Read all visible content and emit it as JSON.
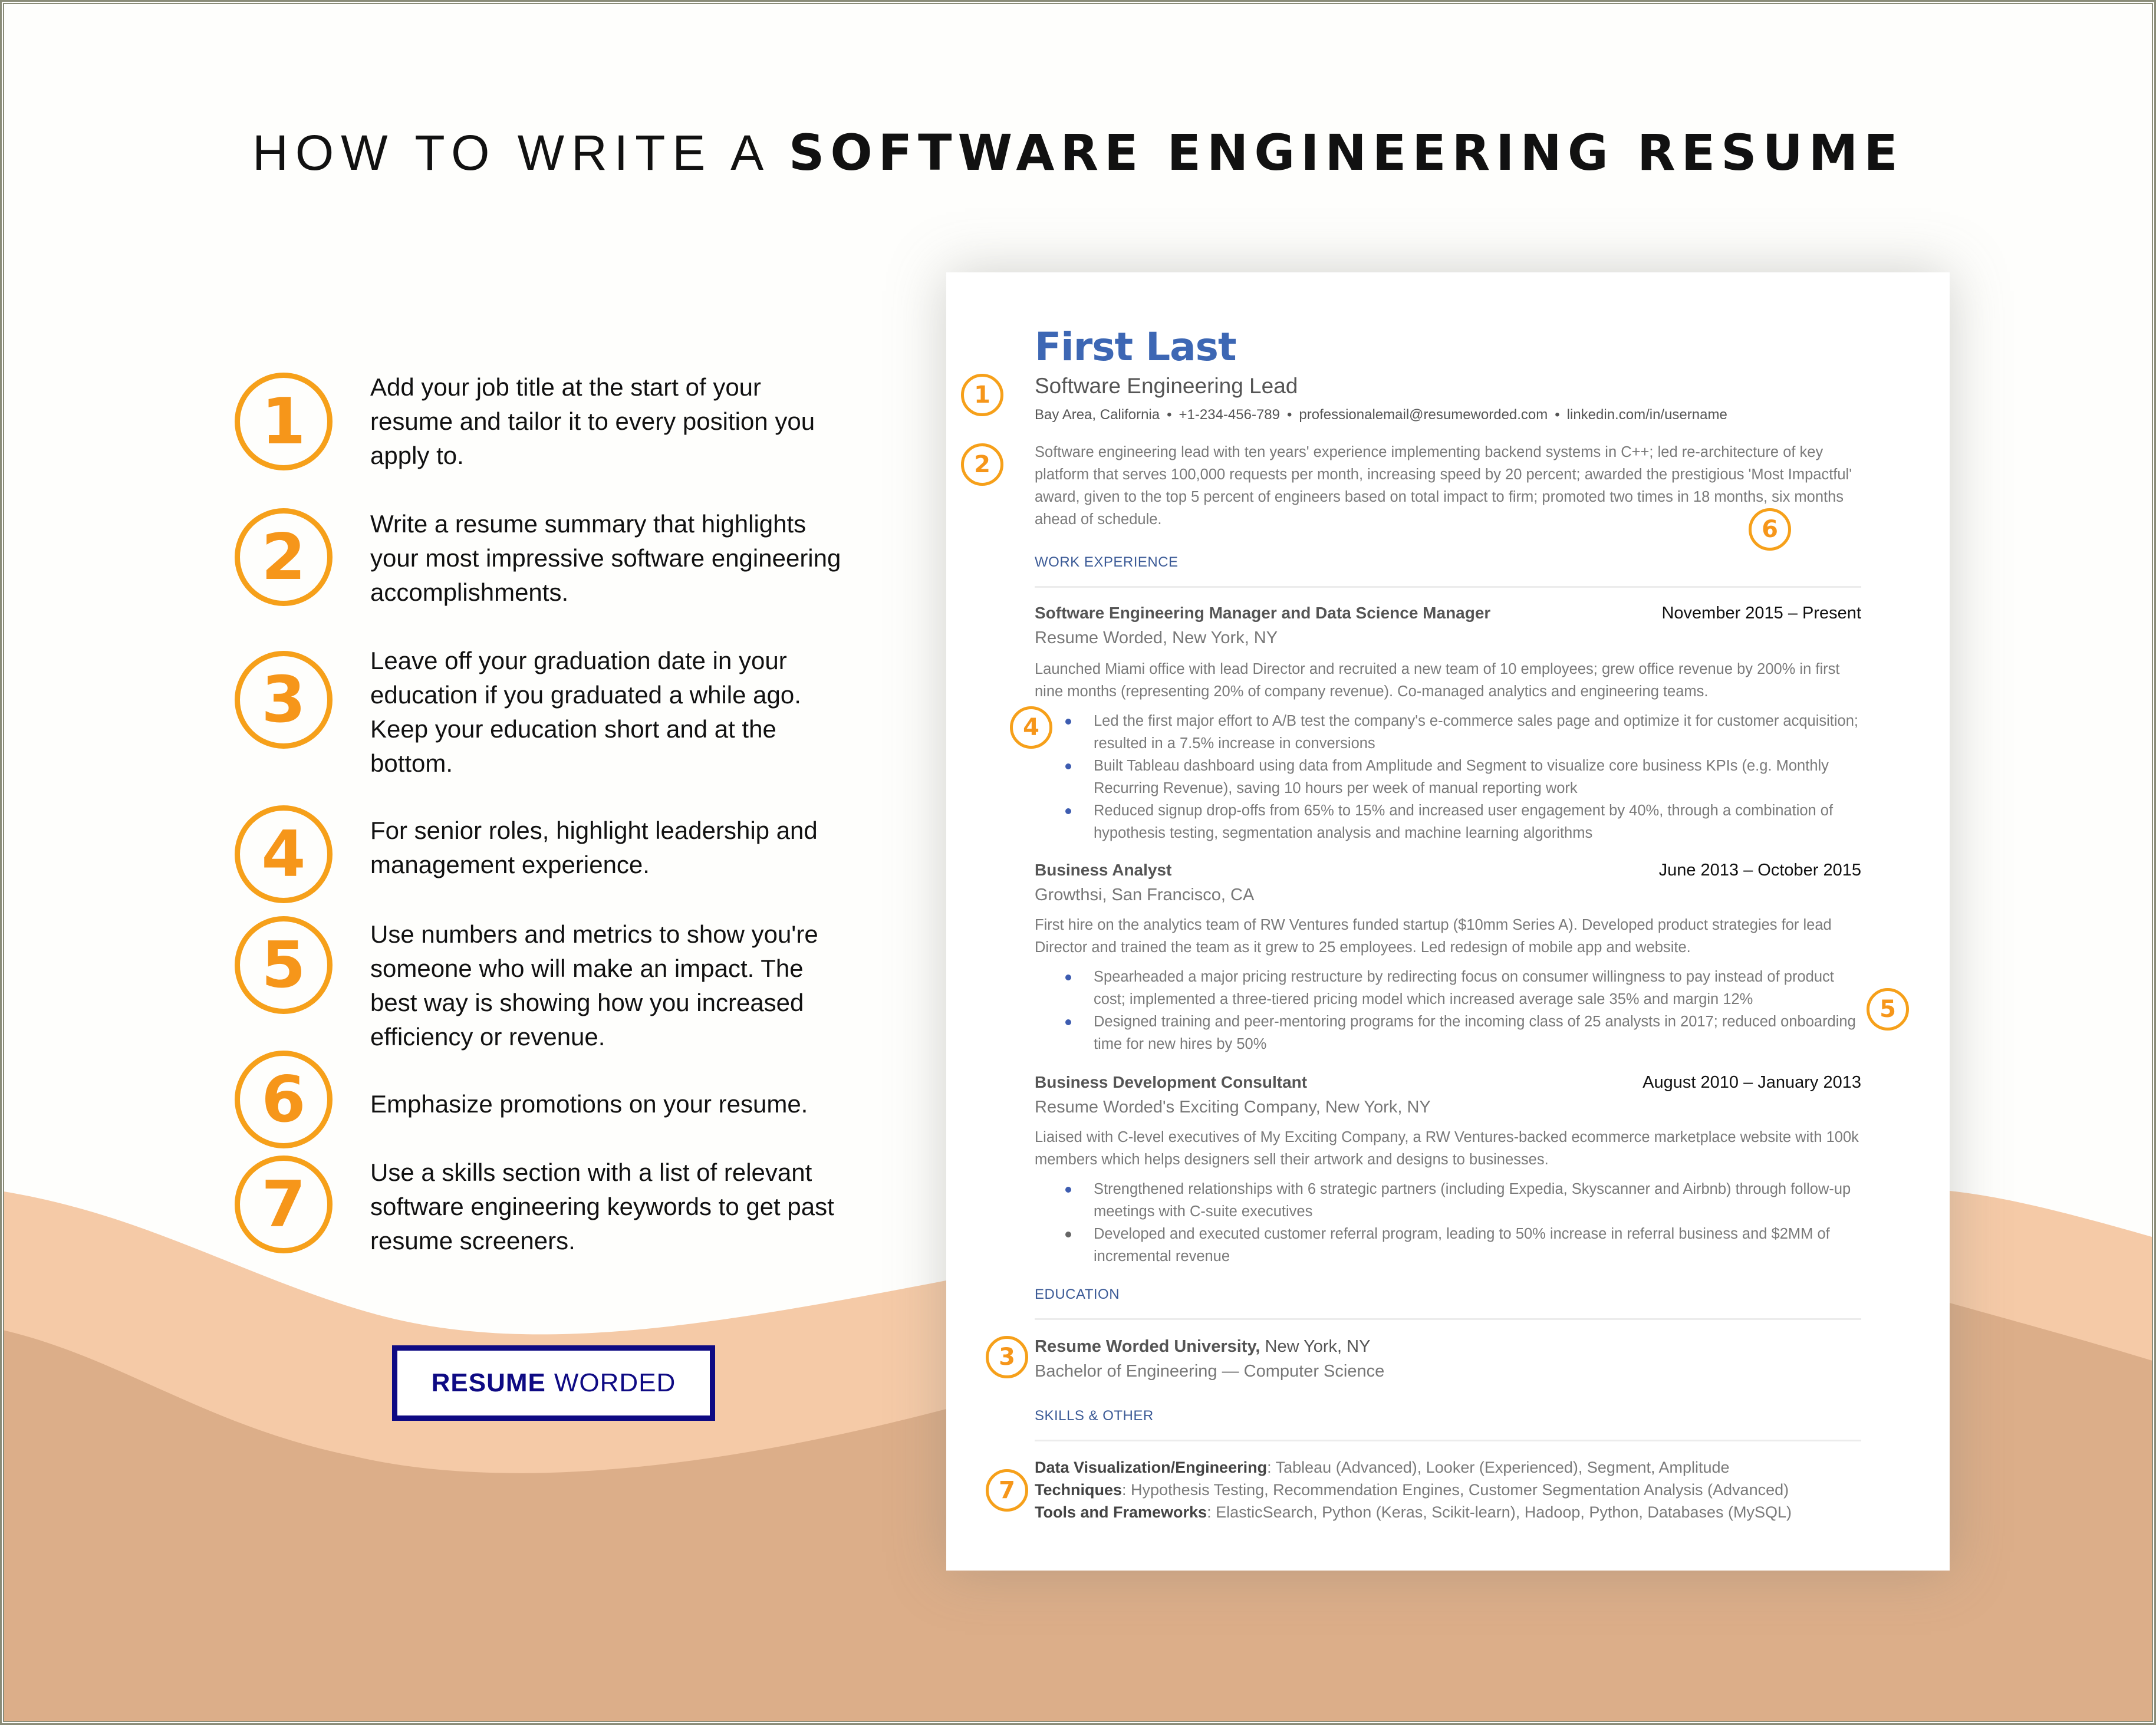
{
  "headline": {
    "light": "HOW TO WRITE A ",
    "bold": "SOFTWARE ENGINEERING RESUME"
  },
  "tips": [
    {
      "num": "1",
      "text": "Add your job title at the start of your resume and tailor it to every position you apply to."
    },
    {
      "num": "2",
      "text": "Write a resume summary that highlights your most impressive software engineering accomplishments."
    },
    {
      "num": "3",
      "text": "Leave off your graduation date in your education if you graduated a while ago. Keep your education short and at the bottom."
    },
    {
      "num": "4",
      "text": "For senior roles, highlight leadership and management experience."
    },
    {
      "num": "5",
      "text": "Use numbers and metrics to show you're someone who will make an impact. The best way is showing how you increased efficiency or revenue."
    },
    {
      "num": "6",
      "text": "Emphasize promotions on your resume."
    },
    {
      "num": "7",
      "text": "Use a skills section with a list of relevant software engineering keywords to get past resume screeners."
    }
  ],
  "logo": {
    "bold": "RESUME",
    "light": "WORDED"
  },
  "colors": {
    "accent_orange": "#f6a01a",
    "resume_blue": "#3d67b4",
    "logo_navy": "#0e0a83",
    "peach_light": "#f5caa7",
    "peach_dark": "#dcae89"
  },
  "resume": {
    "name": "First Last",
    "title": "Software Engineering Lead",
    "contact": [
      "Bay Area, California",
      "+1-234-456-789",
      "professionalemail@resumeworded.com",
      "linkedin.com/in/username"
    ],
    "contact_sep": "•",
    "summary": "Software engineering lead with ten years' experience implementing backend systems in C++; led re-architecture of key platform that serves 100,000 requests per month, increasing speed by 20 percent; awarded the prestigious 'Most Impactful' award, given to the top 5 percent of engineers based on total impact to firm; promoted two times in 18 months, six months ahead of schedule.",
    "sections": {
      "work": "WORK EXPERIENCE",
      "education": "EDUCATION",
      "skills": "SKILLS & OTHER"
    },
    "jobs": [
      {
        "title": "Software Engineering Manager and Data Science Manager",
        "dates": "November 2015 – Present",
        "company": "Resume Worded, New York, NY",
        "desc": "Launched Miami office with lead Director and recruited a new team of 10 employees; grew office revenue by 200% in first nine months (representing 20% of company revenue). Co-managed analytics and engineering teams.",
        "bullets": [
          "Led the first major effort to A/B test the company's e-commerce sales page and optimize it for customer acquisition; resulted in a 7.5% increase in conversions",
          "Built Tableau dashboard using data from Amplitude and Segment to visualize core business KPIs (e.g. Monthly Recurring Revenue), saving 10 hours per week of manual reporting work",
          "Reduced signup drop-offs from 65% to 15% and increased user engagement by 40%, through a combination of hypothesis testing, segmentation analysis and machine learning algorithms"
        ]
      },
      {
        "title": "Business Analyst",
        "dates": "June 2013 – October 2015",
        "company": "Growthsi, San Francisco, CA",
        "desc": "First hire on the analytics team of RW Ventures funded startup ($10mm Series A). Developed product strategies for lead Director and trained the team as it grew to 25 employees. Led redesign of mobile app and website.",
        "bullets": [
          "Spearheaded a major pricing restructure by redirecting focus on consumer willingness to pay instead of product cost; implemented a three-tiered pricing model which increased average sale 35% and margin 12%",
          "Designed training and peer-mentoring programs for the incoming class of 25 analysts in 2017; reduced onboarding time for new hires by 50%"
        ]
      },
      {
        "title": "Business Development Consultant",
        "dates": "August 2010 – January 2013",
        "company": "Resume Worded's Exciting Company, New York, NY",
        "desc": "Liaised with C-level executives of My Exciting Company, a RW Ventures-backed ecommerce marketplace website with 100k members which helps designers sell their artwork and designs to businesses.",
        "bullets": [
          "Strengthened relationships with 6 strategic partners (including Expedia, Skyscanner and Airbnb) through follow-up meetings with C-suite executives",
          "Developed and executed customer referral program, leading to 50% increase in referral business and $2MM of incremental revenue"
        ]
      }
    ],
    "education": {
      "school": "Resume Worded University,",
      "location": " New York, NY",
      "degree": "Bachelor of Engineering — Computer Science"
    },
    "skills": [
      {
        "label": "Data Visualization/Engineering",
        "value": ": Tableau (Advanced), Looker (Experienced), Segment, Amplitude"
      },
      {
        "label": "Techniques",
        "value": ": Hypothesis Testing, Recommendation Engines, Customer Segmentation Analysis (Advanced)"
      },
      {
        "label": "Tools and Frameworks",
        "value": ": ElasticSearch, Python (Keras, Scikit-learn), Hadoop, Python, Databases (MySQL)"
      }
    ],
    "badges": [
      "1",
      "2",
      "6",
      "4",
      "5",
      "3",
      "7"
    ]
  }
}
